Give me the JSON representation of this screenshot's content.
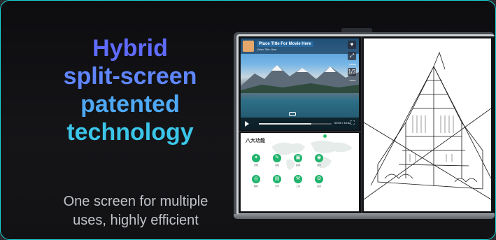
{
  "promo": {
    "headline_lines": [
      "Hybrid",
      "split-screen",
      "patented",
      "technology"
    ],
    "subline_lines": [
      "One screen for multiple",
      "uses, highly efficient"
    ]
  },
  "video_player": {
    "title": "Place Title For Movie Here",
    "subtitle": "Video Title Here",
    "side_buttons": [
      "♥",
      "⤢",
      "1/3"
    ],
    "side_captions": [
      "",
      "SHARE",
      "VIDEO"
    ],
    "time": "00:00 / 44:32",
    "progress": 0.72
  },
  "app_launcher": {
    "title": "八大功能",
    "apps": [
      {
        "label": "智能",
        "icon": "compass-icon"
      },
      {
        "label": "白板",
        "icon": "pen-icon"
      },
      {
        "label": "投屏",
        "icon": "screen-icon"
      },
      {
        "label": "会议",
        "icon": "meeting-icon"
      },
      {
        "label": "相机",
        "icon": "camera-icon"
      },
      {
        "label": "文件",
        "icon": "file-icon"
      },
      {
        "label": "工具",
        "icon": "tool-icon"
      },
      {
        "label": "设置",
        "icon": "settings-icon"
      }
    ]
  },
  "colors": {
    "border": "#19d6d6",
    "headline_top": "#5f6bff",
    "headline_bottom": "#3bc6e9",
    "app_green": "#1fb36b"
  }
}
